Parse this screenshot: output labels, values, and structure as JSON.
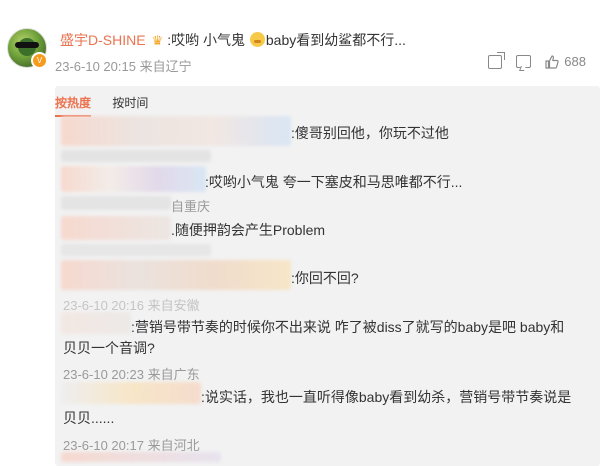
{
  "post": {
    "author": "盛宇D-SHINE",
    "text_prefix": ":哎哟 小气鬼 ",
    "text_suffix": "baby看到幼鲨都不行...",
    "time": "23-6-10 20:15",
    "location": "来自辽宁",
    "like_count": "688"
  },
  "tabs": [
    "按热度",
    "按时间"
  ],
  "comments": [
    {
      "text": ":傻哥别回他，你玩不过他"
    },
    {
      "text": ":哎哟小气鬼 夸一下塞皮和马思唯都不行..."
    },
    {
      "partial_meta": "自重庆",
      "text": ".随便押韵会产生Problem"
    },
    {
      "text": ":你回不回?"
    },
    {
      "partial_meta": "23-6-10 20:16 来自安徽",
      "text_line1": ":营销号带节奏的时候你不出来说 咋了被diss了就写的baby是吧 baby和",
      "text_line2": "贝贝一个音调?"
    },
    {
      "meta": "23-6-10 20:23 来自广东",
      "text_line1": ":说实话，我也一直听得像baby看到幼杀，营销号带节奏说是",
      "text_line2": "贝贝......"
    },
    {
      "meta": "23-6-10 20:17 来自河北"
    }
  ],
  "colors": {
    "author": "#eb7350",
    "active_tab": "#eb7350",
    "meta": "#999999",
    "panel_bg": "#f2f2f2"
  }
}
